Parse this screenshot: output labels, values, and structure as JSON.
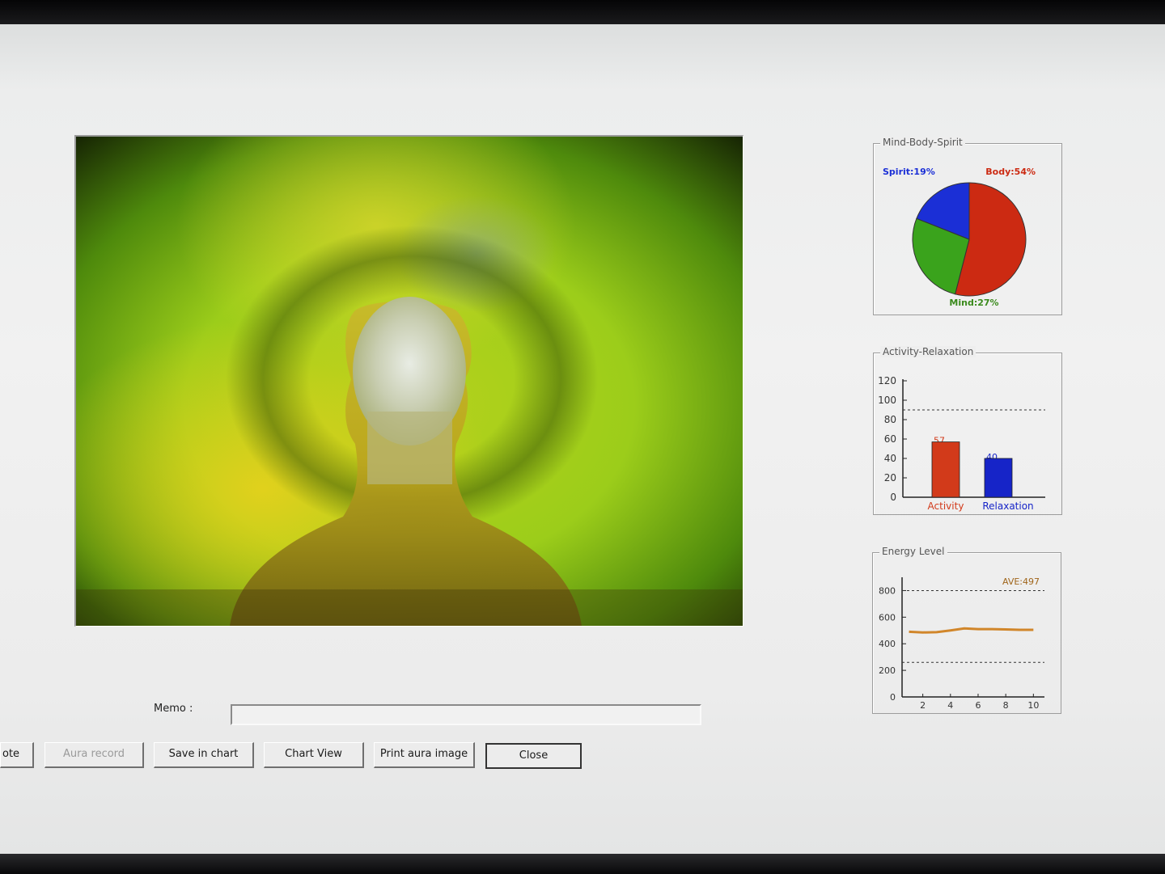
{
  "memo": {
    "label": "Memo :",
    "value": ""
  },
  "buttons": {
    "note": "ote",
    "aura_record": "Aura record",
    "save_in_chart": "Save in chart",
    "chart_view": "Chart View",
    "print_aura_image": "Print aura image",
    "close": "Close"
  },
  "panels": {
    "mind_body_spirit": {
      "title": "Mind-Body-Spirit",
      "labels": {
        "spirit": "Spirit:19%",
        "body": "Body:54%",
        "mind": "Mind:27%"
      }
    },
    "activity_relaxation": {
      "title": "Activity-Relaxation",
      "value_labels": {
        "activity": "57",
        "relaxation": "40"
      }
    },
    "energy_level": {
      "title": "Energy Level",
      "average": "AVE:497"
    }
  },
  "colors": {
    "body": "#cc2a12",
    "mind": "#3aa31c",
    "spirit": "#1b2fd6",
    "activity": "#d23a1a",
    "relaxation": "#1624c8",
    "energy_line": "#d1862a"
  },
  "chart_data": [
    {
      "type": "pie",
      "title": "Mind-Body-Spirit",
      "categories": [
        "Body",
        "Mind",
        "Spirit"
      ],
      "values": [
        54,
        27,
        19
      ]
    },
    {
      "type": "bar",
      "title": "Activity-Relaxation",
      "categories": [
        "Activity",
        "Relaxation"
      ],
      "values": [
        57,
        40
      ],
      "ylim": [
        0,
        120
      ],
      "yticks": [
        0,
        20,
        40,
        60,
        80,
        100,
        120
      ],
      "reference_line": 90
    },
    {
      "type": "line",
      "title": "Energy Level",
      "x": [
        1,
        2,
        3,
        4,
        5,
        6,
        7,
        8,
        9,
        10
      ],
      "series": [
        {
          "values": [
            490,
            485,
            487,
            500,
            515,
            510,
            510,
            508,
            505,
            505
          ]
        }
      ],
      "ylim": [
        0,
        900
      ],
      "yticks": [
        0,
        200,
        400,
        600,
        800
      ],
      "xticks": [
        2,
        4,
        6,
        8,
        10
      ],
      "reference_lines": [
        800,
        260
      ]
    }
  ]
}
